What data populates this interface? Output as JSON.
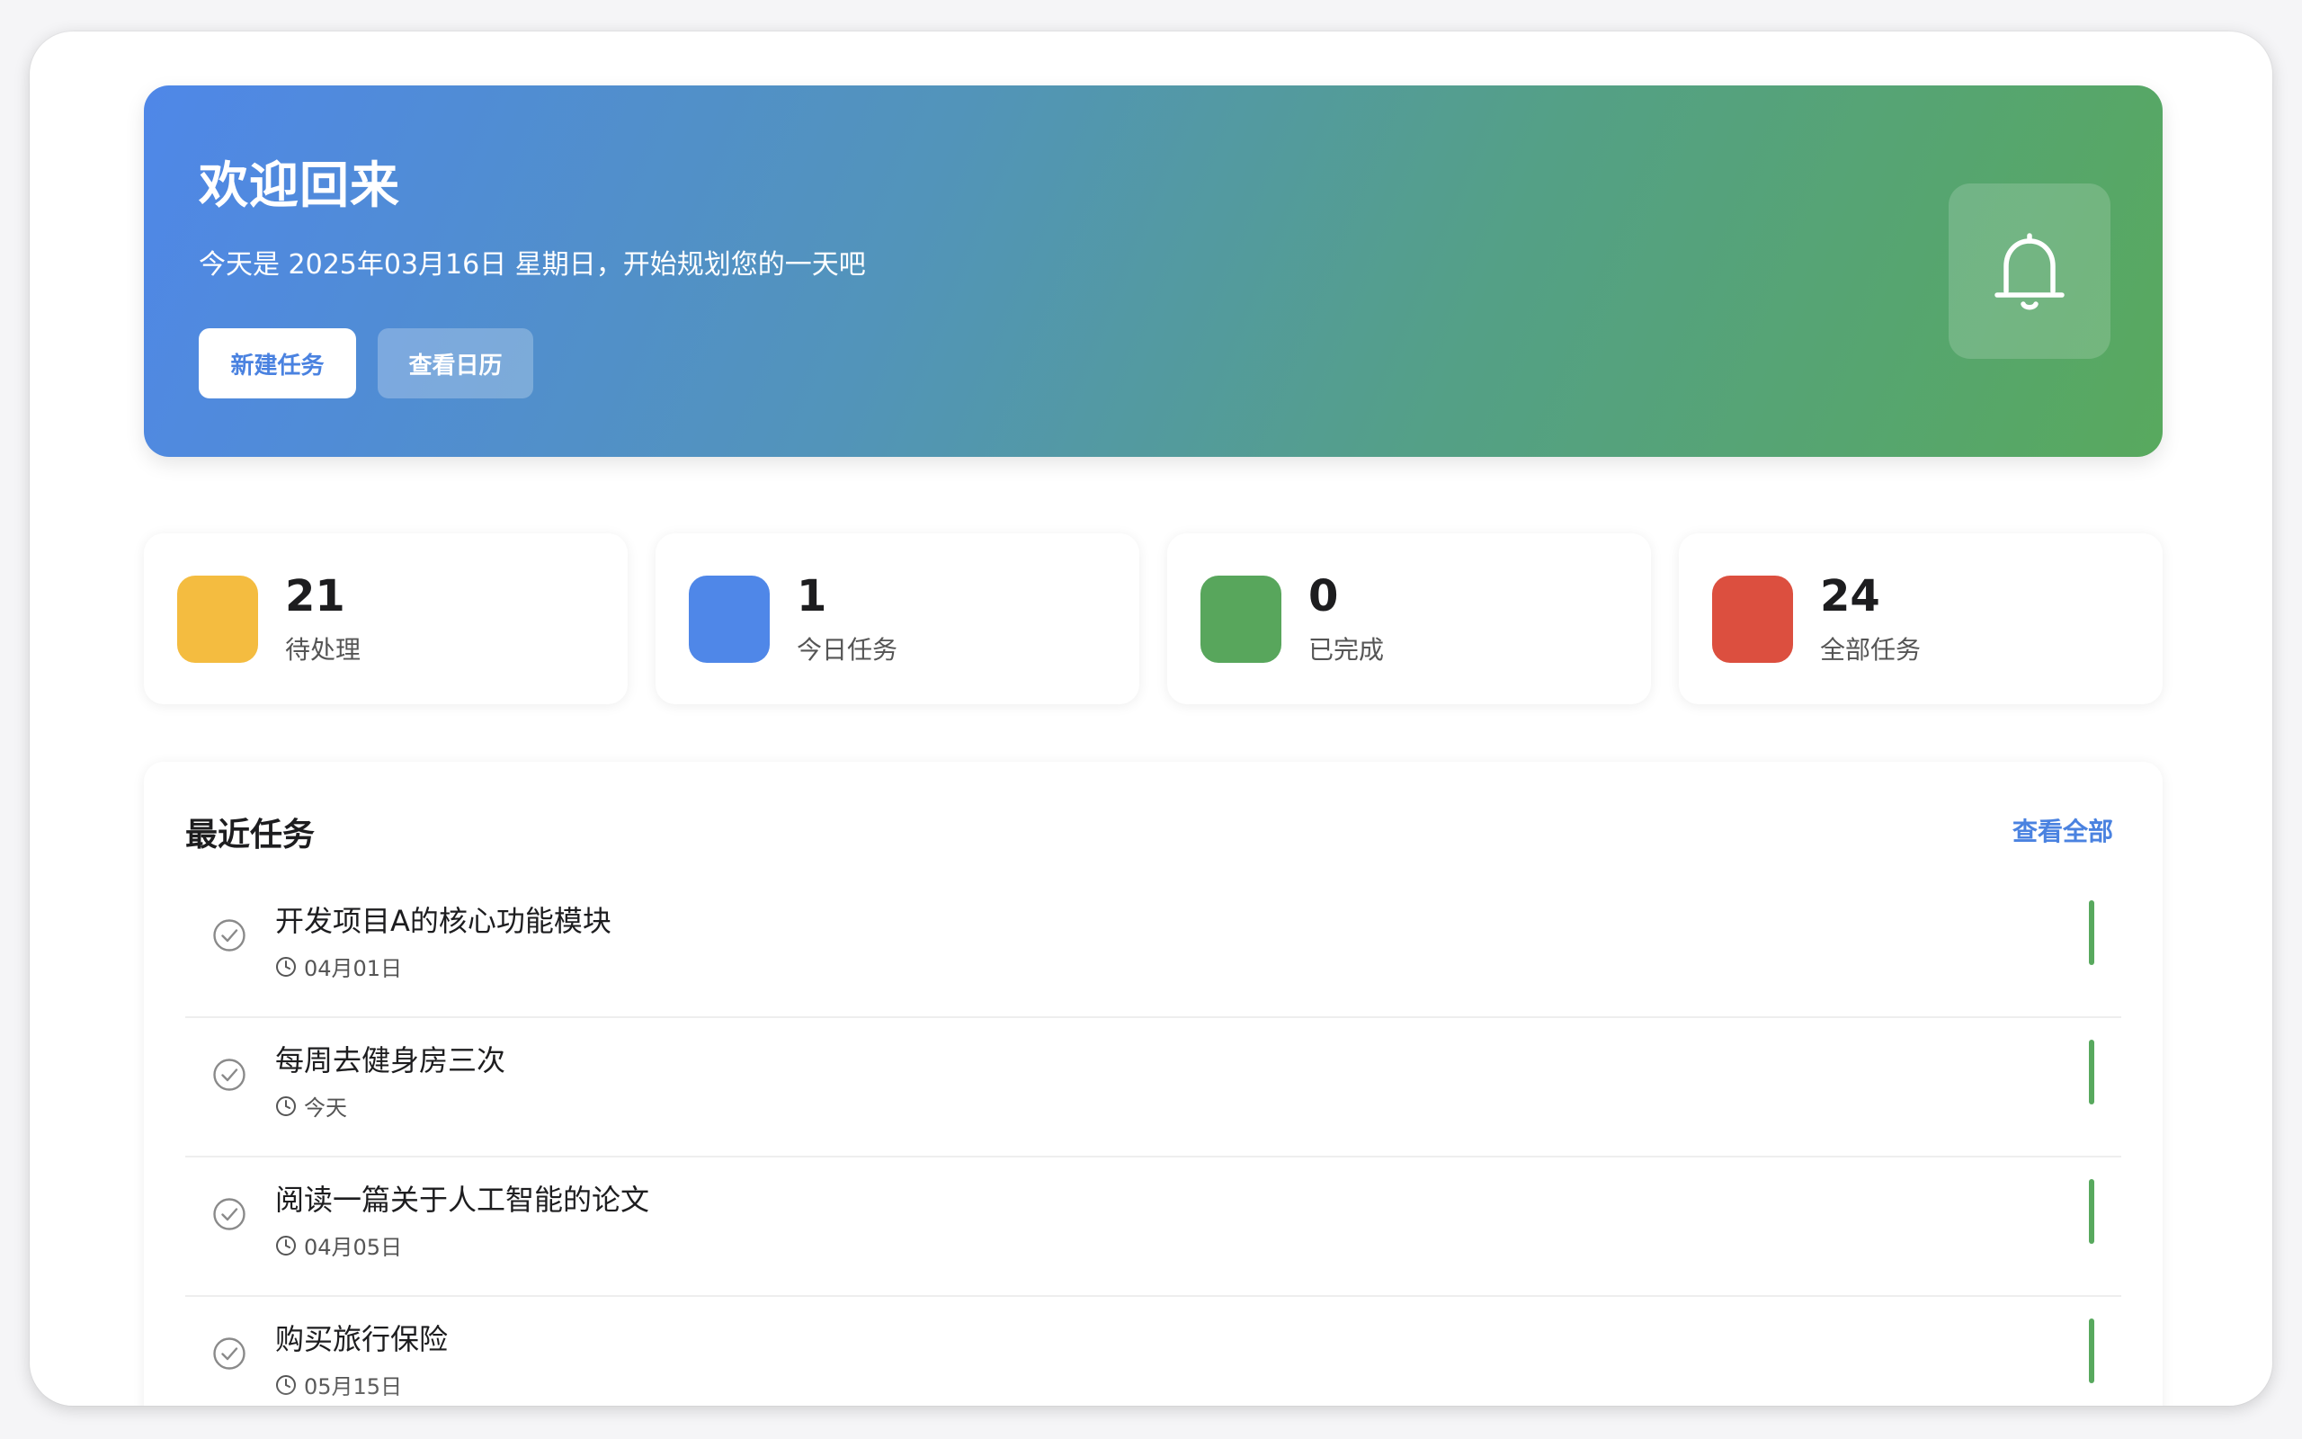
{
  "hero": {
    "title": "欢迎回来",
    "subtitle": "今天是 2025年03月16日 星期日，开始规划您的一天吧",
    "new_task_label": "新建任务",
    "view_calendar_label": "查看日历",
    "icon": "bell-icon"
  },
  "stats": [
    {
      "value": "21",
      "label": "待处理",
      "color": "#f4bc40"
    },
    {
      "value": "1",
      "label": "今日任务",
      "color": "#4f87e8"
    },
    {
      "value": "0",
      "label": "已完成",
      "color": "#58a65c"
    },
    {
      "value": "24",
      "label": "全部任务",
      "color": "#dc4f3f"
    }
  ],
  "recent": {
    "title": "最近任务",
    "view_all_label": "查看全部",
    "tasks": [
      {
        "name": "开发项目A的核心功能模块",
        "date": "04月01日",
        "priority_color": "#58a95e"
      },
      {
        "name": "每周去健身房三次",
        "date": "今天",
        "priority_color": "#58a95e"
      },
      {
        "name": "阅读一篇关于人工智能的论文",
        "date": "04月05日",
        "priority_color": "#58a95e"
      },
      {
        "name": "购买旅行保险",
        "date": "05月15日",
        "priority_color": "#58a95e"
      }
    ]
  }
}
